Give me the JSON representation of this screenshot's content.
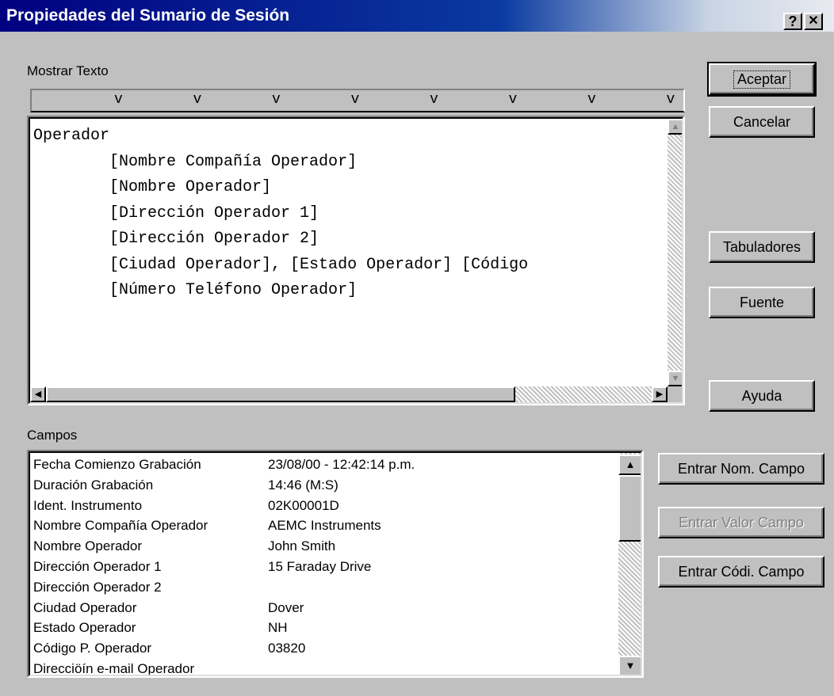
{
  "window": {
    "title": "Propiedades del Sumario de Sesión",
    "help_glyph": "?",
    "close_glyph": "✕"
  },
  "text_section": {
    "label": "Mostrar Texto",
    "tab_marker": "v",
    "tab_count": 8,
    "lines": [
      "Operador",
      "        [Nombre Compañía Operador]",
      "        [Nombre Operador]",
      "        [Dirección Operador 1]",
      "        [Dirección Operador 2]",
      "        [Ciudad Operador], [Estado Operador] [Código",
      "        [Número Teléfono Operador]"
    ]
  },
  "fields_section": {
    "label": "Campos",
    "rows": [
      {
        "name": "Fecha Comienzo Grabación",
        "value": "23/08/00 - 12:42:14 p.m."
      },
      {
        "name": "Duración Grabación",
        "value": "14:46 (M:S)"
      },
      {
        "name": "Ident. Instrumento",
        "value": "02K00001D"
      },
      {
        "name": "Nombre Compañía Operador",
        "value": "AEMC Instruments"
      },
      {
        "name": "Nombre Operador",
        "value": "John Smith"
      },
      {
        "name": "Dirección Operador 1",
        "value": "15 Faraday Drive"
      },
      {
        "name": "Dirección Operador 2",
        "value": ""
      },
      {
        "name": "Ciudad Operador",
        "value": "Dover"
      },
      {
        "name": "Estado Operador",
        "value": "NH"
      },
      {
        "name": "Código P. Operador",
        "value": "03820"
      },
      {
        "name": "Direcciöín e-mail Operador",
        "value": ""
      }
    ]
  },
  "buttons": {
    "accept": "Aceptar",
    "cancel": "Cancelar",
    "tabs": "Tabuladores",
    "font": "Fuente",
    "help": "Ayuda",
    "enter_field_name": "Entrar Nom. Campo",
    "enter_field_value": "Entrar Valor Campo",
    "enter_field_code": "Entrar Códi. Campo"
  }
}
